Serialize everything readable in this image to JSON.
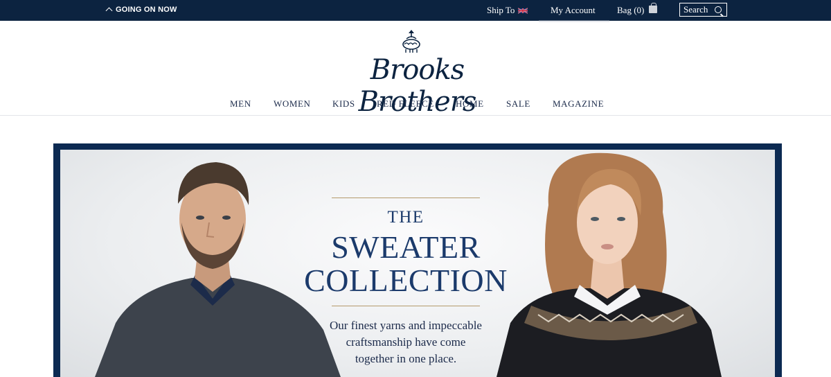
{
  "topbar": {
    "going_on_now": "GOING ON NOW",
    "ship_to": "Ship To",
    "my_account": "My Account",
    "bag": "Bag (0)",
    "search": "Search"
  },
  "brand": {
    "name": "Brooks Brothers"
  },
  "nav": {
    "items": [
      "MEN",
      "WOMEN",
      "KIDS",
      "RED FLEECE",
      "HOME",
      "SALE",
      "MAGAZINE"
    ]
  },
  "hero": {
    "eyebrow": "THE",
    "title_line1": "SWEATER",
    "title_line2": "COLLECTION",
    "tagline_line1": "Our finest yarns and impeccable",
    "tagline_line2": "craftsmanship have come",
    "tagline_line3": "together in one place."
  },
  "colors": {
    "navy": "#0c2340",
    "hero_frame": "#0c2a52",
    "gold_rule": "#b49a6b",
    "headline_blue": "#1b3a6b"
  },
  "icons": [
    "caret-up-icon",
    "uk-flag-icon",
    "shopping-bag-icon",
    "search-icon",
    "golden-fleece-logo-icon"
  ]
}
